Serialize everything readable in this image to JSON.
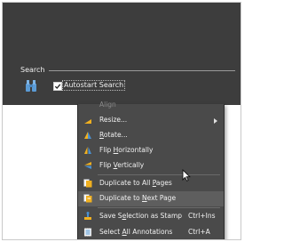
{
  "search": {
    "section_label": "Search",
    "autostart": {
      "label": "Autostart Search",
      "checked": true
    },
    "icon": "binoculars-icon"
  },
  "context_menu": {
    "partial_item_label": "Align",
    "resize": {
      "label": "Resize...",
      "icon": "resize-icon",
      "has_submenu": true
    },
    "rotate": {
      "pre": "",
      "accel": "R",
      "post": "otate...",
      "icon": "rotate-icon"
    },
    "flip_h": {
      "pre": "Flip ",
      "accel": "H",
      "post": "orizontally",
      "icon": "flip-horizontal-icon"
    },
    "flip_v": {
      "pre": "Flip ",
      "accel": "V",
      "post": "ertically",
      "icon": "flip-vertical-icon"
    },
    "dup_all": {
      "pre": "Duplicate to All ",
      "accel": "P",
      "post": "ages",
      "icon": "duplicate-all-pages-icon"
    },
    "dup_next": {
      "pre": "Duplicate to ",
      "accel": "N",
      "post": "ext Page",
      "icon": "duplicate-next-page-icon",
      "hovered": true
    },
    "stamp": {
      "pre": "Save S",
      "accel": "e",
      "post": "lection as Stamp",
      "shortcut": "Ctrl+Ins",
      "icon": "stamp-icon"
    },
    "select_all": {
      "pre": "Select ",
      "accel": "A",
      "post": "ll Annotations",
      "shortcut": "Ctrl+A",
      "icon": "select-all-icon"
    }
  },
  "colors": {
    "panel_bg": "#3d3d3d",
    "menu_bg": "#4a4a4a",
    "menu_hover": "#5e5e5e",
    "icon_yellow": "#f0b020",
    "icon_blue": "#4a90d0"
  }
}
